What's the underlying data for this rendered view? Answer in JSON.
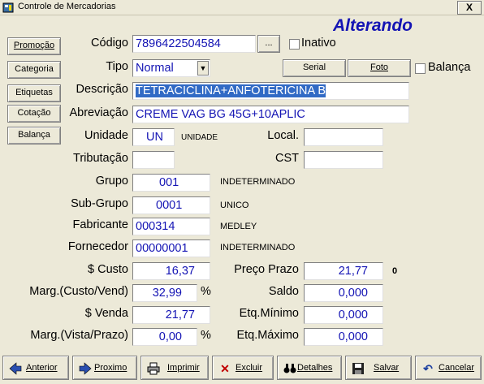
{
  "window": {
    "title": "Controle de Mercadorias",
    "close_label": "X"
  },
  "mode_label": "Alterando",
  "side_buttons": [
    "Promoção",
    "Categoria",
    "Etiquetas",
    "Cotação",
    "Balança"
  ],
  "labels": {
    "codigo": "Código",
    "tipo": "Tipo",
    "descricao": "Descrição",
    "abreviacao": "Abreviação",
    "unidade": "Unidade",
    "local": "Local.",
    "tributacao": "Tributação",
    "cst": "CST",
    "grupo": "Grupo",
    "subgrupo": "Sub-Grupo",
    "fabricante": "Fabricante",
    "fornecedor": "Fornecedor",
    "custo": "$ Custo",
    "preco_prazo": "Preço Prazo",
    "marg_custo_vend": "Marg.(Custo/Vend)",
    "saldo": "Saldo",
    "venda": "$ Venda",
    "etq_minimo": "Etq.Mínimo",
    "marg_vista_prazo": "Marg.(Vista/Prazo)",
    "etq_maximo": "Etq.Máximo",
    "inativo": "Inativo",
    "balanca_check": "Balança",
    "percent1": "%",
    "percent2": "%"
  },
  "fields": {
    "codigo": "7896422504584",
    "codigo_lookup": "...",
    "tipo": "Normal",
    "descricao": "TETRACICLINA+ANFOTERICINA B",
    "abreviacao": "CREME VAG BG 45G+10APLIC",
    "unidade": "UN",
    "unidade_desc": "UNIDADE",
    "local": "",
    "tributacao": "",
    "cst": "",
    "grupo": "001",
    "grupo_desc": "INDETERMINADO",
    "subgrupo": "0001",
    "subgrupo_desc": "UNICO",
    "fabricante": "000314",
    "fabricante_desc": "MEDLEY",
    "fornecedor": "00000001",
    "fornecedor_desc": "INDETERMINADO",
    "custo": "16,37",
    "preco_prazo": "21,77",
    "preco_prazo_extra": "0",
    "marg_custo_vend": "32,99",
    "saldo": "0,000",
    "venda": "21,77",
    "etq_minimo": "0,000",
    "marg_vista_prazo": "0,00",
    "etq_maximo": "0,000"
  },
  "top_buttons": {
    "serial": "Serial",
    "foto": "Foto"
  },
  "bottom_buttons": [
    {
      "label": "Anterior",
      "icon": "arrow-left-icon"
    },
    {
      "label": "Proximo",
      "icon": "arrow-right-icon"
    },
    {
      "label": "Imprimir",
      "icon": "printer-icon"
    },
    {
      "label": "Excluir",
      "icon": "delete-icon"
    },
    {
      "label": "Detalhes",
      "icon": "binoculars-icon"
    },
    {
      "label": "Salvar",
      "icon": "floppy-icon"
    },
    {
      "label": "Cancelar",
      "icon": "undo-icon"
    }
  ],
  "colors": {
    "value_text": "#1414b4",
    "selection": "#316ac5",
    "window_bg": "#ece9d8"
  }
}
